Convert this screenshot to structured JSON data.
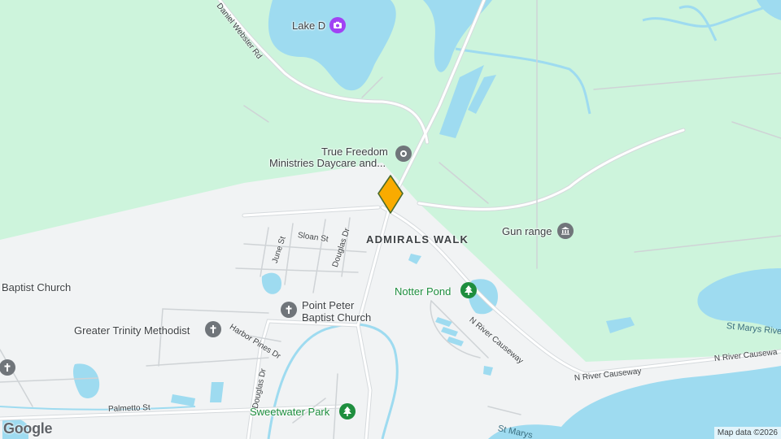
{
  "map": {
    "colors": {
      "land": "#f1f3f4",
      "park": "#cdf4dc",
      "water": "#9edbf0",
      "road": "#ffffff",
      "road_outline": "#d3d7db",
      "pin": "#f9ab00",
      "pin_outline": "#4a6b2c",
      "park_icon": "#1e8e3e",
      "church_icon": "#70757a",
      "lake_icon": "#a142f4"
    },
    "places": {
      "lake_d": "Lake D",
      "true_freedom_line1": "True Freedom",
      "true_freedom_line2": "Ministries Daycare and...",
      "gun_range": "Gun range",
      "admirals_walk": "ADMIRALS WALK",
      "notter_pond": "Notter Pond",
      "point_peter_line1": "Point Peter",
      "point_peter_line2": "Baptist Church",
      "greater_trinity": "Greater Trinity Methodist",
      "baptist_church": "Baptist Church",
      "sweetwater_park": "Sweetwater Park"
    },
    "roads": {
      "daniel_webster": "Daniel Webster Rd",
      "sloan": "Sloan St",
      "june": "June St",
      "douglas_upper": "Douglas Dr",
      "douglas_lower": "Douglas Dr",
      "harbor_pines": "Harbor Pines Dr",
      "palmetto": "Palmetto St",
      "n_river_causeway_1": "N River Causeway",
      "n_river_causeway_2": "N River Causeway",
      "n_river_causeway_3": "N River Causewa"
    },
    "water": {
      "st_marys_right": "St Marys Rive",
      "st_marys_bottom": "St Marys"
    },
    "icons": {
      "lake_d": "camera-icon",
      "true_freedom": "place-pin-icon",
      "gun_range": "museum-icon",
      "notter_pond": "tree-icon",
      "point_peter": "cross-icon",
      "greater_trinity": "cross-icon",
      "baptist_church": "cross-icon",
      "sweetwater_park": "tree-icon",
      "location": "diamond-pin-icon"
    },
    "logo": "Google",
    "attribution": "Map data ©2026"
  }
}
